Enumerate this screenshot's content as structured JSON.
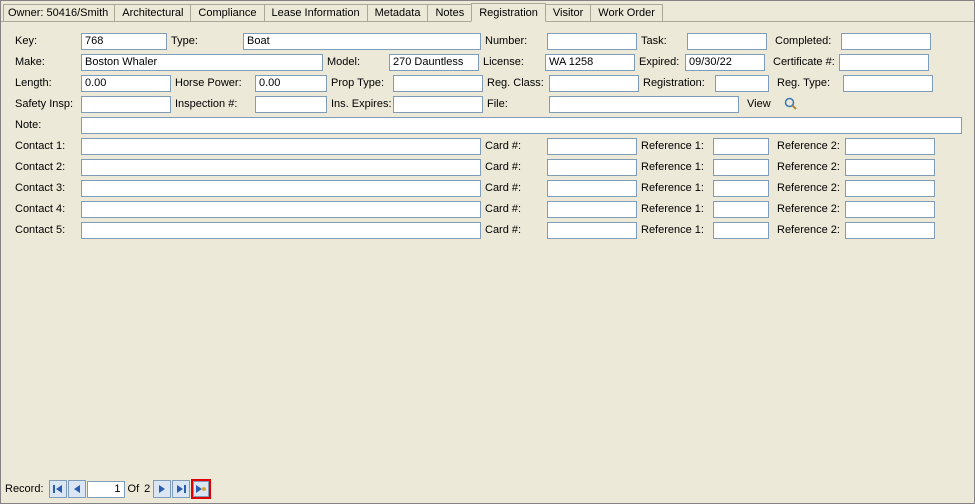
{
  "owner": "Owner:  50416/Smith",
  "tabs": {
    "architectural": "Architectural",
    "compliance": "Compliance",
    "lease": "Lease Information",
    "metadata": "Metadata",
    "notes": "Notes",
    "registration": "Registration",
    "visitor": "Visitor",
    "workorder": "Work Order"
  },
  "labels": {
    "key": "Key:",
    "type": "Type:",
    "number": "Number:",
    "task": "Task:",
    "completed": "Completed:",
    "make": "Make:",
    "model": "Model:",
    "license": "License:",
    "expired": "Expired:",
    "certificate": "Certificate #:",
    "length": "Length:",
    "hp": "Horse Power:",
    "proptype": "Prop Type:",
    "regclass": "Reg. Class:",
    "registration": "Registration:",
    "regtype": "Reg. Type:",
    "safetyinsp": "Safety Insp:",
    "inspno": "Inspection #:",
    "insexp": "Ins. Expires:",
    "file": "File:",
    "view": "View",
    "note": "Note:",
    "contact1": "Contact 1:",
    "contact2": "Contact 2:",
    "contact3": "Contact 3:",
    "contact4": "Contact 4:",
    "contact5": "Contact 5:",
    "card": "Card #:",
    "ref1": "Reference 1:",
    "ref2": "Reference 2:"
  },
  "values": {
    "key": "768",
    "type": "Boat",
    "number": "",
    "task": "",
    "completed": "",
    "make": "Boston Whaler",
    "model": "270 Dauntless",
    "license": "WA 1258",
    "expired": "09/30/22",
    "certificate": "",
    "length": "0.00",
    "hp": "0.00",
    "proptype": "",
    "regclass": "",
    "registration": "",
    "regtype": "",
    "safetyinsp": "",
    "inspno": "",
    "insexp": "",
    "file": "",
    "note": "",
    "contacts": [
      {
        "c": "",
        "card": "",
        "r1": "",
        "r2": ""
      },
      {
        "c": "",
        "card": "",
        "r1": "",
        "r2": ""
      },
      {
        "c": "",
        "card": "",
        "r1": "",
        "r2": ""
      },
      {
        "c": "",
        "card": "",
        "r1": "",
        "r2": ""
      },
      {
        "c": "",
        "card": "",
        "r1": "",
        "r2": ""
      }
    ]
  },
  "recordbar": {
    "label": "Record:",
    "current": "1",
    "of": "Of",
    "total": "2"
  }
}
